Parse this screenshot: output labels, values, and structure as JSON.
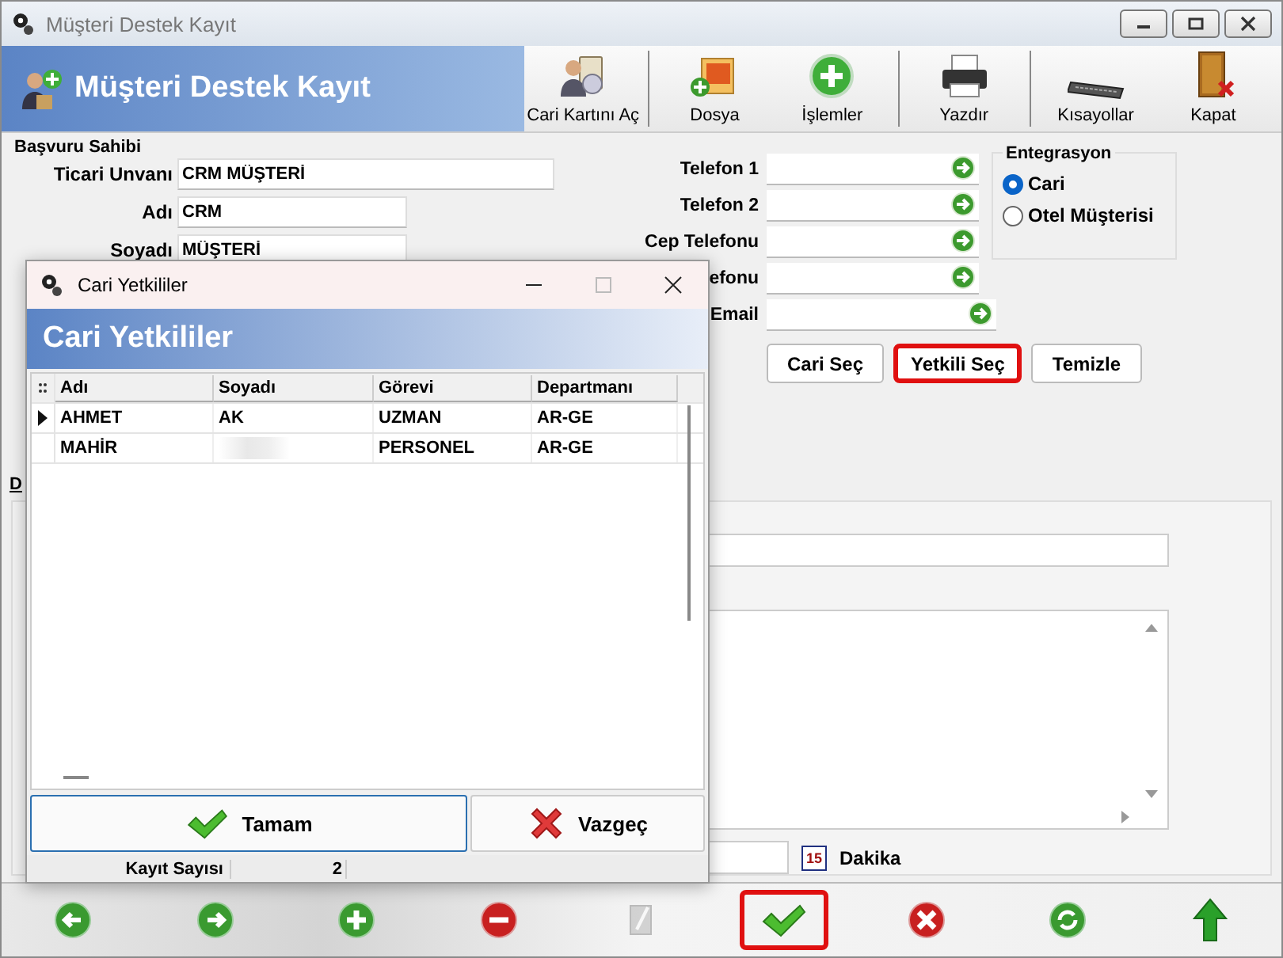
{
  "window": {
    "title": "Müşteri Destek Kayıt"
  },
  "header": {
    "title": "Müşteri Destek Kayıt"
  },
  "toolbar": [
    {
      "kind": "card",
      "label": "Cari Kartını Aç"
    },
    {
      "kind": "file",
      "label": "Dosya"
    },
    {
      "kind": "add",
      "label": "İşlemler"
    },
    {
      "kind": "print",
      "label": "Yazdır"
    },
    {
      "kind": "keyboard",
      "label": "Kısayollar"
    },
    {
      "kind": "exit",
      "label": "Kapat"
    }
  ],
  "applicant": {
    "legend": "Başvuru Sahibi",
    "fields": [
      {
        "label": "Ticari Unvanı",
        "value": "CRM MÜŞTERİ"
      },
      {
        "label": "Adı",
        "value": "CRM"
      },
      {
        "label": "Soyadı",
        "value": "MÜŞTERİ"
      }
    ],
    "phones": [
      {
        "label": "Telefon 1"
      },
      {
        "label": "Telefon 2"
      },
      {
        "label": "Cep Telefonu"
      },
      {
        "label": "efonu"
      },
      {
        "label": "Email"
      }
    ],
    "integration": {
      "legend": "Entegrasyon",
      "options": [
        {
          "label": "Cari",
          "selected": true
        },
        {
          "label": "Otel Müşterisi",
          "selected": false
        }
      ]
    },
    "buttons": [
      {
        "label": "Cari Seç",
        "highlighted": false
      },
      {
        "label": "Yetkili Seç",
        "highlighted": true
      },
      {
        "label": "Temizle",
        "highlighted": false
      }
    ]
  },
  "tab": {
    "label": "D"
  },
  "detail": {
    "calendar_day": "15",
    "unit": "Dakika"
  },
  "bottom_toolbar": [
    {
      "kind": "back",
      "highlighted": false,
      "disabled": false
    },
    {
      "kind": "forward",
      "highlighted": false,
      "disabled": false
    },
    {
      "kind": "add",
      "highlighted": false,
      "disabled": false
    },
    {
      "kind": "remove",
      "highlighted": false,
      "disabled": false
    },
    {
      "kind": "edit",
      "highlighted": false,
      "disabled": true
    },
    {
      "kind": "save",
      "highlighted": true,
      "disabled": false
    },
    {
      "kind": "cancel",
      "highlighted": false,
      "disabled": false
    },
    {
      "kind": "refresh",
      "highlighted": false,
      "disabled": false
    },
    {
      "kind": "up",
      "highlighted": false,
      "disabled": false
    }
  ],
  "dialog": {
    "title": "Cari Yetkililer",
    "header": "Cari Yetkililer",
    "columns": [
      "Adı",
      "Soyadı",
      "Görevi",
      "Departmanı"
    ],
    "rows": [
      {
        "selected": true,
        "cells": [
          {
            "text": "AHMET"
          },
          {
            "text": "AK"
          },
          {
            "text": "UZMAN"
          },
          {
            "text": "AR-GE"
          }
        ]
      },
      {
        "selected": false,
        "cells": [
          {
            "text": "MAHİR"
          },
          {
            "redacted": true
          },
          {
            "text": "PERSONEL"
          },
          {
            "text": "AR-GE"
          }
        ]
      }
    ],
    "buttons": [
      {
        "kind": "ok",
        "label": "Tamam",
        "focused": true
      },
      {
        "kind": "cancel",
        "label": "Vazgeç",
        "focused": false
      }
    ],
    "footer": {
      "label": "Kayıt Sayısı",
      "count": "2"
    }
  }
}
